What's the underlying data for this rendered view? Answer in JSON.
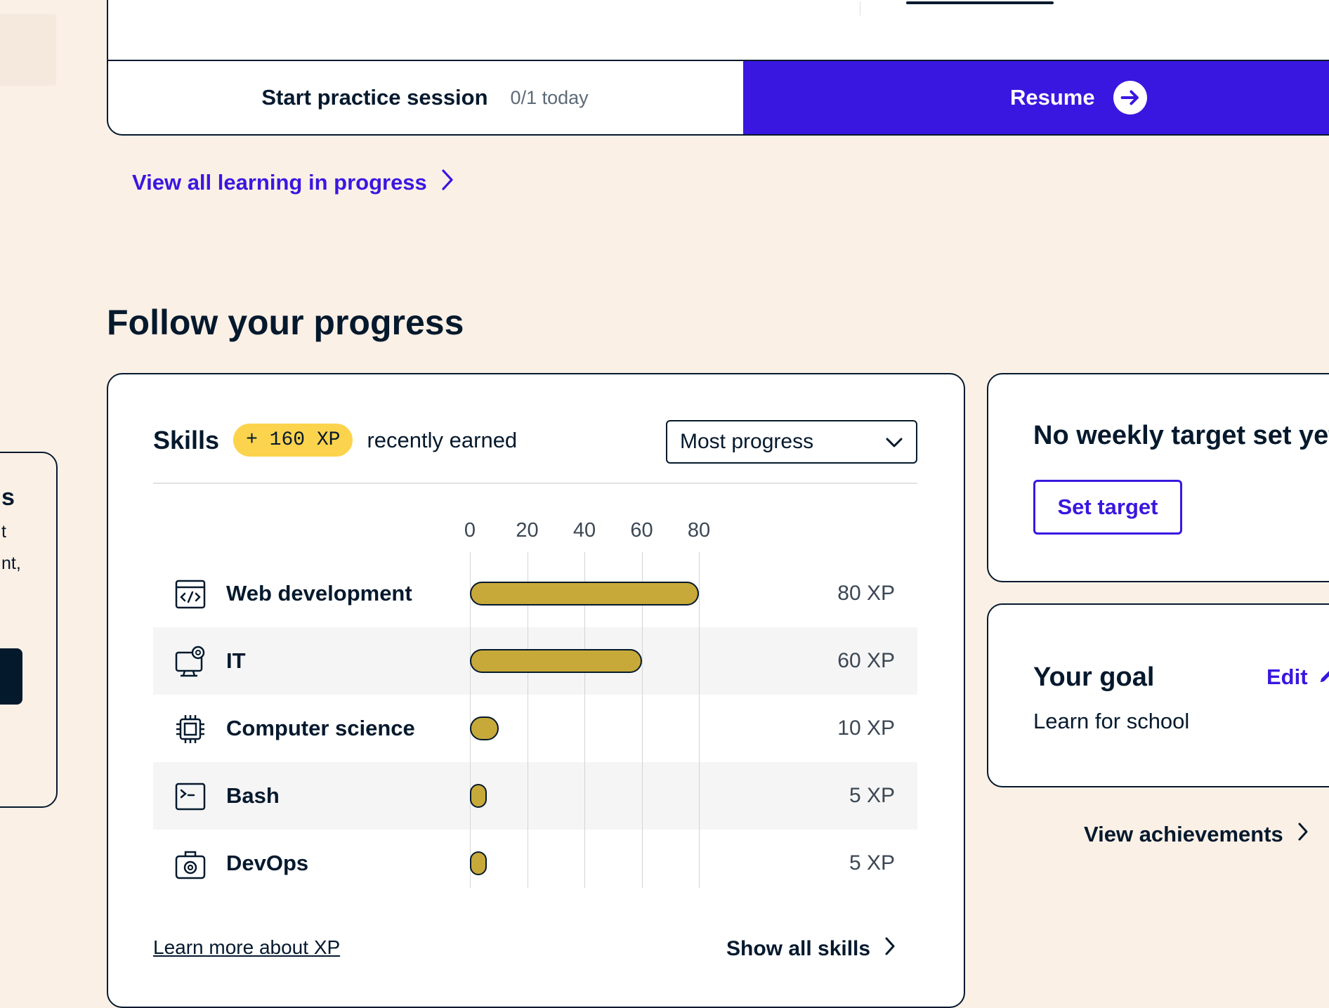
{
  "left_sidebar": {
    "fragments": [
      "s",
      "t",
      "nt,"
    ]
  },
  "practice": {
    "label": "Start practice session",
    "count": "0/1 today"
  },
  "resume": {
    "label": "Resume"
  },
  "view_all_link": "View all learning in progress",
  "section_title": "Follow your progress",
  "skills": {
    "title": "Skills",
    "xp_badge": "+ 160 XP",
    "recent_text": "recently earned",
    "sort_select": {
      "value": "Most progress"
    },
    "learn_more": "Learn more about XP",
    "show_all": "Show all skills"
  },
  "chart_data": {
    "type": "bar",
    "orientation": "horizontal",
    "x_ticks": [
      "0",
      "20",
      "40",
      "60",
      "80"
    ],
    "xlim": [
      0,
      80
    ],
    "grid": true,
    "categories": [
      "Web development",
      "IT",
      "Computer science",
      "Bash",
      "DevOps"
    ],
    "values": [
      80,
      60,
      10,
      5,
      5
    ],
    "value_labels": [
      "80 XP",
      "60 XP",
      "10 XP",
      "5 XP",
      "5 XP"
    ],
    "icons": [
      "code-window-icon",
      "monitor-gear-icon",
      "chip-icon",
      "terminal-icon",
      "toolbox-gear-icon"
    ],
    "bar_color": "#c7a93a"
  },
  "weekly_target": {
    "title": "No weekly target set yet",
    "button": "Set target"
  },
  "goal": {
    "title": "Your goal",
    "edit": "Edit",
    "description": "Learn for school"
  },
  "achievements_link": "View achievements",
  "colors": {
    "accent": "#3a17e0",
    "background": "#fbf0e6",
    "navy": "#05192d",
    "badge": "#fcd34d"
  }
}
